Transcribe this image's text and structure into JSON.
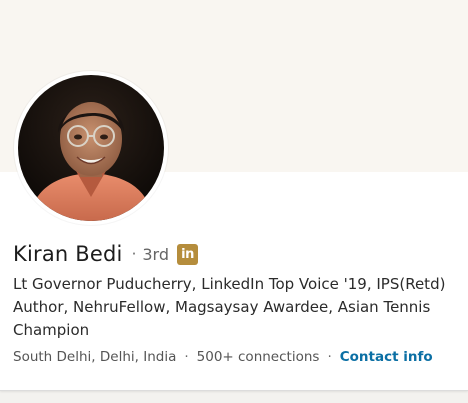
{
  "profile": {
    "name": "Kiran Bedi",
    "degree": "3rd",
    "badge_text": "in",
    "headline_lines": [
      "Lt Governor Puducherry, LinkedIn Top Voice '19, IPS(Retd)",
      "Author, NehruFellow, Magsaysay Awardee, Asian Tennis",
      "Champion"
    ],
    "location": "South Delhi, Delhi, India",
    "connections": "500+ connections",
    "contact_label": "Contact info"
  },
  "separators": {
    "dot": "·"
  },
  "colors": {
    "cover": "#f9f6f1",
    "badge": "#b58d3c",
    "link": "#0b6fa4",
    "name": "#1c1c1c"
  },
  "icons": {
    "badge": "linkedin-premium-icon"
  }
}
